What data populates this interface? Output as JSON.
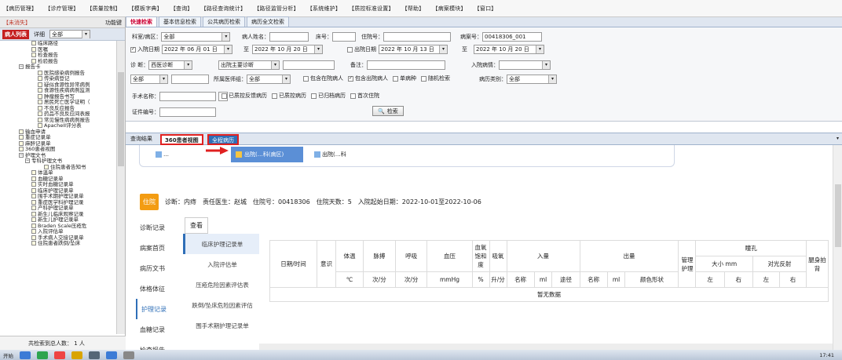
{
  "menu": [
    "【病历管理】",
    "【诊疗管理】",
    "【质量控制】",
    "【模板字典】",
    "【查询】",
    "【路径查询统计】",
    "【路径监管分析】",
    "【系统维护】",
    "【质控标准设置】",
    "【帮助】",
    "【病案模块】",
    "【窗口】"
  ],
  "left": {
    "title": "【未消失】",
    "func": "功能键",
    "tab_active": "病人列表",
    "tab2": "详细",
    "select": "全部",
    "footer": "共检索到总人数：  1  人",
    "tree": [
      {
        "t": "临床路径",
        "l": 5,
        "k": "i"
      },
      {
        "t": "医嘱",
        "l": 5,
        "k": "i"
      },
      {
        "t": "检查报告",
        "l": 5,
        "k": "i"
      },
      {
        "t": "检验报告",
        "l": 5,
        "k": "i"
      },
      {
        "t": "报告卡",
        "l": 3,
        "k": "g"
      },
      {
        "t": "医院感染病例报告",
        "l": 6,
        "k": "i"
      },
      {
        "t": "传染病登记",
        "l": 6,
        "k": "i"
      },
      {
        "t": "疑似食源性异常病例",
        "l": 6,
        "k": "i"
      },
      {
        "t": "食源性疾病病例监测",
        "l": 6,
        "k": "i"
      },
      {
        "t": "肿瘤报告书写",
        "l": 6,
        "k": "i"
      },
      {
        "t": "居民死亡医学证明（",
        "l": 6,
        "k": "i"
      },
      {
        "t": "不良反应报告",
        "l": 6,
        "k": "i"
      },
      {
        "t": "药品不良反应间表报",
        "l": 6,
        "k": "i"
      },
      {
        "t": "常见慢性病病例报告",
        "l": 6,
        "k": "i"
      },
      {
        "t": "ApacheII评分表",
        "l": 6,
        "k": "i"
      },
      {
        "t": "输血申请",
        "l": 3,
        "k": "i"
      },
      {
        "t": "重症记录单",
        "l": 3,
        "k": "i"
      },
      {
        "t": "麻醉记录单",
        "l": 3,
        "k": "i"
      },
      {
        "t": "360患者视图",
        "l": 3,
        "k": "i"
      },
      {
        "t": "护理文书",
        "l": 3,
        "k": "g"
      },
      {
        "t": "专科护理文书",
        "l": 4,
        "k": "g"
      },
      {
        "t": "住院患者告知书",
        "l": 7,
        "k": "i"
      },
      {
        "t": "体温单",
        "l": 5,
        "k": "i"
      },
      {
        "t": "血糖记录单",
        "l": 5,
        "k": "i"
      },
      {
        "t": "实时血糖记录单",
        "l": 5,
        "k": "i"
      },
      {
        "t": "临床护理记录单",
        "l": 5,
        "k": "i"
      },
      {
        "t": "围手术期护理记录单",
        "l": 5,
        "k": "i"
      },
      {
        "t": "重症医学科护理记录",
        "l": 5,
        "k": "i"
      },
      {
        "t": "产科护理记录单",
        "l": 5,
        "k": "i"
      },
      {
        "t": "新生儿临床观察记录",
        "l": 5,
        "k": "i"
      },
      {
        "t": "新生儿护理记录单",
        "l": 5,
        "k": "i"
      },
      {
        "t": "Braden Scale压疮危",
        "l": 5,
        "k": "i"
      },
      {
        "t": "入院评估单",
        "l": 5,
        "k": "i"
      },
      {
        "t": "手术病人交接记录单",
        "l": 5,
        "k": "i"
      },
      {
        "t": "住院患者跌倒/坠床",
        "l": 5,
        "k": "i"
      }
    ]
  },
  "toptabs": [
    "快速检索",
    "基本信息检索",
    "公共病历检索",
    "病历全文检索"
  ],
  "form": {
    "ward_label": "科室/病区：",
    "ward_val": "全部",
    "name_label": "病人姓名：",
    "bed_label": "床号：",
    "inp_label": "住院号：",
    "case_label": "病案号：",
    "case_val": "00418306_001",
    "in_label": "入院日期",
    "d1": "2022 年 06 月 01 日",
    "to": "至",
    "d2": "2022 年 10 月 20 日",
    "out_label": "出院日期",
    "d3": "2022 年 10 月 13 日",
    "d4": "2022 年 10 月 20 日",
    "diag_label": "诊    断：",
    "diag1": "西医诊断",
    "diag2": "出院主要诊断",
    "note_label": "备注：",
    "adm_label": "入院病情：",
    "all1": "全部",
    "doc_label": "所属医师组：",
    "all2": "全部",
    "c1": "包含在院病人",
    "c2": "包含出院病人",
    "c3": "单病种",
    "c4": "随机检索",
    "type_label": "病历类别：",
    "all3": "全部",
    "op_label": "手术名称：",
    "c5": "已质控反馈病历",
    "c6": "已质控病历",
    "c7": "已归档病历",
    "c8": "首次住院",
    "cert_label": "证件编号：",
    "search": "检索"
  },
  "tabs2": {
    "result": "查询结果",
    "view": "360患者视图",
    "all": "全程病历"
  },
  "pills": [
    "…",
    "出院(…科(病区)",
    "出院(…科"
  ],
  "info": {
    "badge": "住院",
    "diag": "诊断：内痔",
    "doctor": "责任医生：赵城",
    "inp": "住院号：00418306",
    "days": "住院天数：5",
    "dates": "入院起始日期：2022-10-01至2022-10-06"
  },
  "sidemenu": [
    "诊断记录",
    "病案首页",
    "病历文书",
    "体格体征",
    "护理记录",
    "血糖记录",
    "检查报告"
  ],
  "view_btn": "查看",
  "sub": [
    "临床护理记录单",
    "入院评估单",
    "压疮危险因素评估表",
    "跌倒/坠床危险因素评估",
    "围手术期护理记录单"
  ],
  "table": {
    "h": [
      "日期/时间",
      "意识",
      "体温",
      "脉搏",
      "呼吸",
      "血压",
      "血氧饱和度",
      "吸氧",
      "入量",
      "出量",
      "管理护理",
      "瞳孔",
      "腿身拍背"
    ],
    "u": [
      "℃",
      "次/分",
      "次/分",
      "mmHg",
      "%",
      "升/分",
      "名称",
      "ml",
      "途径",
      "名称",
      "ml",
      "颜色形状",
      "大小 mm",
      "对光反射",
      "左",
      "右",
      "左",
      "右"
    ],
    "empty": "暂无数据"
  },
  "time": "17:41"
}
